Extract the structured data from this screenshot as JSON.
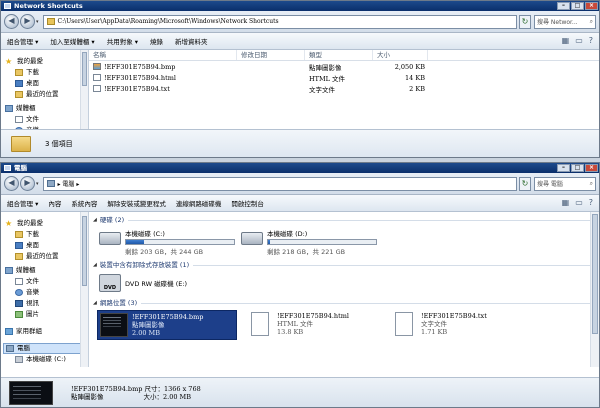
{
  "top": {
    "title": "Network Shortcuts",
    "address": "C:\\Users\\User\\AppData\\Roaming\\Microsoft\\Windows\\Network Shortcuts",
    "search_placeholder": "搜尋 Networ...",
    "toolbar": [
      "組合管理 ▾",
      "加入至媒體櫃 ▾",
      "共用對象 ▾",
      "燒錄",
      "新增資料夾"
    ],
    "nav": [
      {
        "label": "我的最愛",
        "icon": "star-icon",
        "level": "grp"
      },
      {
        "label": "下載",
        "icon": "downloads-folder-icon",
        "level": "sub"
      },
      {
        "label": "桌面",
        "icon": "desktop-icon",
        "level": "sub"
      },
      {
        "label": "最近的位置",
        "icon": "recent-places-icon",
        "level": "sub"
      },
      {
        "label": "媒體櫃",
        "icon": "library-icon",
        "level": "grp"
      },
      {
        "label": "文件",
        "icon": "documents-icon",
        "level": "sub"
      },
      {
        "label": "音樂",
        "icon": "music-icon",
        "level": "sub"
      }
    ],
    "columns": [
      "名稱",
      "修改日期",
      "類型",
      "大小"
    ],
    "files": [
      {
        "name": "!EFF301E75B94.bmp",
        "date": "",
        "type": "點陣圖影像",
        "size": "2,050 KB",
        "icon": "bitmap-file-icon"
      },
      {
        "name": "!EFF301E75B94.html",
        "date": "",
        "type": "HTML 文件",
        "size": "14 KB",
        "icon": "html-file-icon"
      },
      {
        "name": "!EFF301E75B94.txt",
        "date": "",
        "type": "文字文件",
        "size": "2 KB",
        "icon": "text-file-icon"
      }
    ],
    "details": "3 個項目"
  },
  "bottom": {
    "title": "電腦",
    "breadcrumb": "▸ 電腦 ▸",
    "search_placeholder": "搜尋 電腦",
    "toolbar": [
      "組合管理 ▾",
      "內容",
      "系統內容",
      "解除安裝或變更程式",
      "連線網路磁碟機",
      "開啟控制台"
    ],
    "nav": [
      {
        "label": "我的最愛",
        "icon": "star-icon",
        "level": "grp"
      },
      {
        "label": "下載",
        "icon": "downloads-folder-icon",
        "level": "sub"
      },
      {
        "label": "桌面",
        "icon": "desktop-icon",
        "level": "sub"
      },
      {
        "label": "最近的位置",
        "icon": "recent-places-icon",
        "level": "sub"
      },
      {
        "label": "媒體櫃",
        "icon": "library-icon",
        "level": "grp"
      },
      {
        "label": "文件",
        "icon": "documents-icon",
        "level": "sub"
      },
      {
        "label": "音樂",
        "icon": "music-icon",
        "level": "sub"
      },
      {
        "label": "視訊",
        "icon": "videos-icon",
        "level": "sub"
      },
      {
        "label": "圖片",
        "icon": "pictures-icon",
        "level": "sub"
      },
      {
        "label": "家用群組",
        "icon": "homegroup-icon",
        "level": "grp"
      },
      {
        "label": "電腦",
        "icon": "computer-icon",
        "level": "grp",
        "selected": true
      },
      {
        "label": "本機磁碟 (C:)",
        "icon": "drive-icon",
        "level": "sub"
      }
    ],
    "sections": {
      "hdd": "硬碟 (2)",
      "removable": "裝置中含有卸除式存放裝置 (1)",
      "network": "網路位置 (3)"
    },
    "drives": [
      {
        "name": "本機磁碟 (C:)",
        "free": "剩餘 203 GB，共 244 GB",
        "used_fraction": 0.17
      },
      {
        "name": "本機磁碟 (D:)",
        "free": "剩餘 218 GB，共 221 GB",
        "used_fraction": 0.014
      }
    ],
    "dvd": {
      "name": "DVD RW 磁碟機 (E:)",
      "badge": "DVD"
    },
    "network_items": [
      {
        "name": "!EFF301E75B94.bmp",
        "type": "點陣圖影像",
        "size": "2.00 MB",
        "selected": true
      },
      {
        "name": "!EFF301E75B94.html",
        "type": "HTML 文件",
        "size": "13.8 KB"
      },
      {
        "name": "!EFF301E75B94.txt",
        "type": "文字文件",
        "size": "1.71 KB"
      }
    ],
    "status": {
      "line1": "!EFF301E75B94.bmp  尺寸：1366 x 768",
      "line2_type": "點陣圖影像",
      "line2_size": "大小：2.00 MB"
    }
  }
}
